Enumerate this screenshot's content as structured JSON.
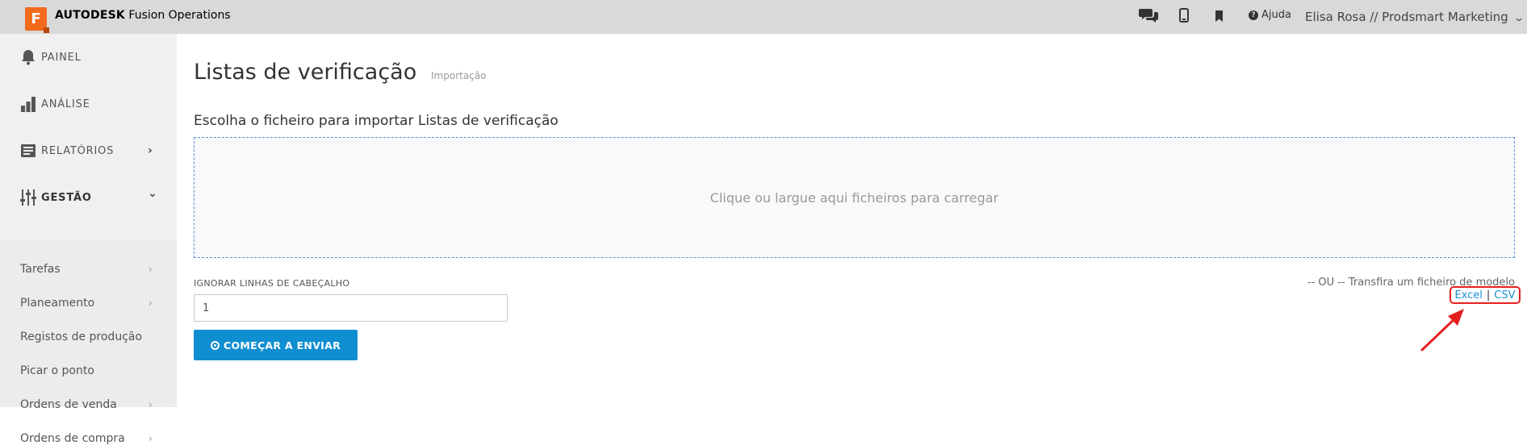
{
  "header": {
    "logo_letter": "F",
    "brand_bold": "AUTODESK",
    "brand_rest": "Fusion Operations",
    "help_label": "Ajuda",
    "user_label": "Elisa Rosa // Prodsmart Marketing",
    "icons": [
      "chat-icon",
      "mobile-icon",
      "bookmark-icon",
      "help-icon",
      "chevron-down-icon"
    ]
  },
  "sidebar": {
    "main_items": [
      {
        "label": "PAINEL",
        "icon": "bell-icon"
      },
      {
        "label": "ANÁLISE",
        "icon": "bar-chart-icon"
      },
      {
        "label": "RELATÓRIOS",
        "icon": "report-icon",
        "arrow": "›"
      },
      {
        "label": "GESTÃO",
        "icon": "sliders-icon",
        "arrow": "⌄"
      }
    ],
    "sub_items": [
      {
        "label": "Tarefas",
        "has_arrow": true
      },
      {
        "label": "Planeamento",
        "has_arrow": true
      },
      {
        "label": "Registos de produção",
        "has_arrow": false
      },
      {
        "label": "Picar o ponto",
        "has_arrow": false
      },
      {
        "label": "Ordens de venda",
        "has_arrow": true
      },
      {
        "label": "Ordens de compra",
        "has_arrow": true
      }
    ]
  },
  "main": {
    "title": "Listas de verificação",
    "subtitle": "Importação",
    "section_title": "Escolha o ficheiro para importar Listas de verificação",
    "dropzone_text": "Clique ou largue aqui ficheiros para carregar",
    "header_lines_label": "IGNORAR LINHAS DE CABEÇALHO",
    "header_lines_value": "1",
    "start_button": "COMEÇAR A ENVIAR",
    "or_text": "-- OU -- Transfira um ficheiro de modelo",
    "template_excel": "Excel",
    "template_separator": "|",
    "template_csv": "CSV"
  },
  "colors": {
    "topbar": "#d9d9d9",
    "logo": "#f26b1d",
    "primary_button": "#0f8fd1",
    "link": "#1a8fd4",
    "annotation_red": "#e4201f"
  }
}
